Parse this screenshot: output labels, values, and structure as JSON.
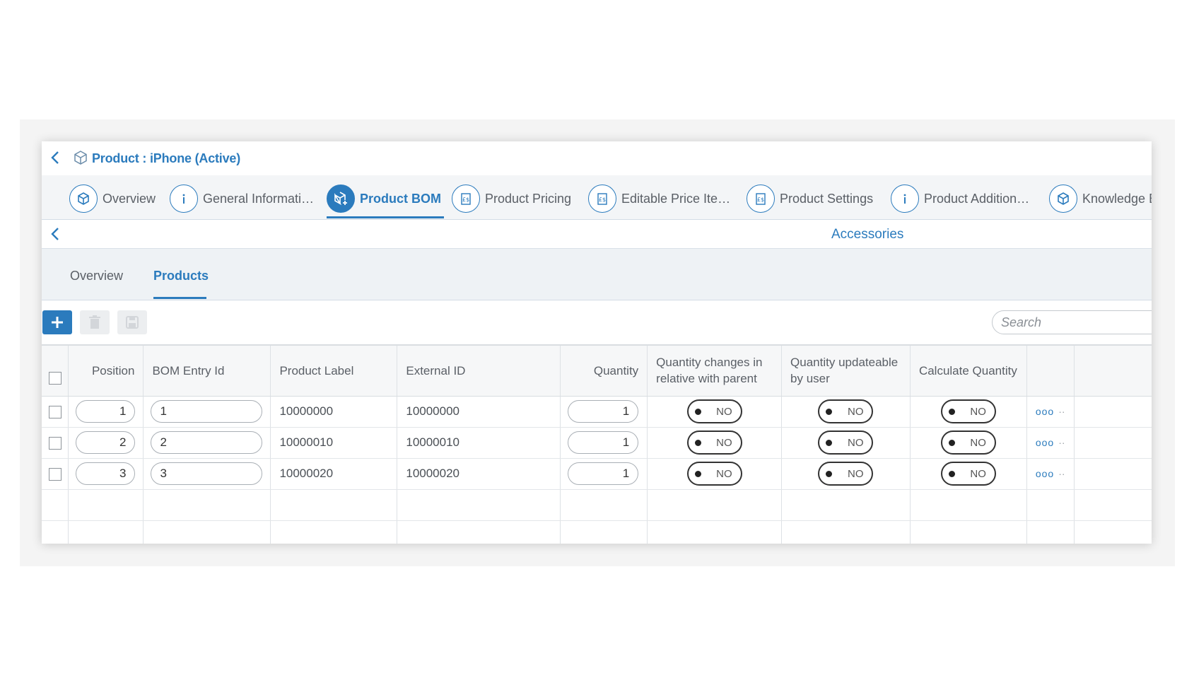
{
  "header": {
    "title": "Product : iPhone (Active)"
  },
  "record_tabs": [
    {
      "label": "Overview",
      "icon": "cube-icon"
    },
    {
      "label": "General Informati…",
      "icon": "info-icon"
    },
    {
      "label": "Product BOM",
      "icon": "bom-icon",
      "active": true
    },
    {
      "label": "Product Pricing",
      "icon": "price-doc-icon"
    },
    {
      "label": "Editable Price Ite…",
      "icon": "price-doc-icon"
    },
    {
      "label": "Product Settings",
      "icon": "price-doc-icon"
    },
    {
      "label": "Product Addition…",
      "icon": "info-icon"
    },
    {
      "label": "Knowledge B",
      "icon": "cube-icon"
    }
  ],
  "section": {
    "title": "Accessories"
  },
  "inner_tabs": [
    {
      "label": "Overview"
    },
    {
      "label": "Products",
      "active": true
    }
  ],
  "toolbar": {
    "search_placeholder": "Search"
  },
  "table": {
    "headers": {
      "position": "Position",
      "bom_entry_id": "BOM Entry Id",
      "product_label": "Product Label",
      "external_id": "External ID",
      "quantity": "Quantity",
      "qty_relative": "Quantity changes in relative with parent",
      "qty_updateable": "Quantity updateable by user",
      "calc_qty": "Calculate Quantity"
    },
    "rows": [
      {
        "position": "1",
        "bom_entry_id": "1",
        "product_label": "10000000",
        "external_id": "10000000",
        "quantity": "1",
        "qty_relative": "NO",
        "qty_updateable": "NO",
        "calc_qty": "NO"
      },
      {
        "position": "2",
        "bom_entry_id": "2",
        "product_label": "10000010",
        "external_id": "10000010",
        "quantity": "1",
        "qty_relative": "NO",
        "qty_updateable": "NO",
        "calc_qty": "NO"
      },
      {
        "position": "3",
        "bom_entry_id": "3",
        "product_label": "10000020",
        "external_id": "10000020",
        "quantity": "1",
        "qty_relative": "NO",
        "qty_updateable": "NO",
        "calc_qty": "NO"
      }
    ],
    "row_actions_glyph": "ooo"
  },
  "colors": {
    "accent": "#2b7bbd"
  }
}
